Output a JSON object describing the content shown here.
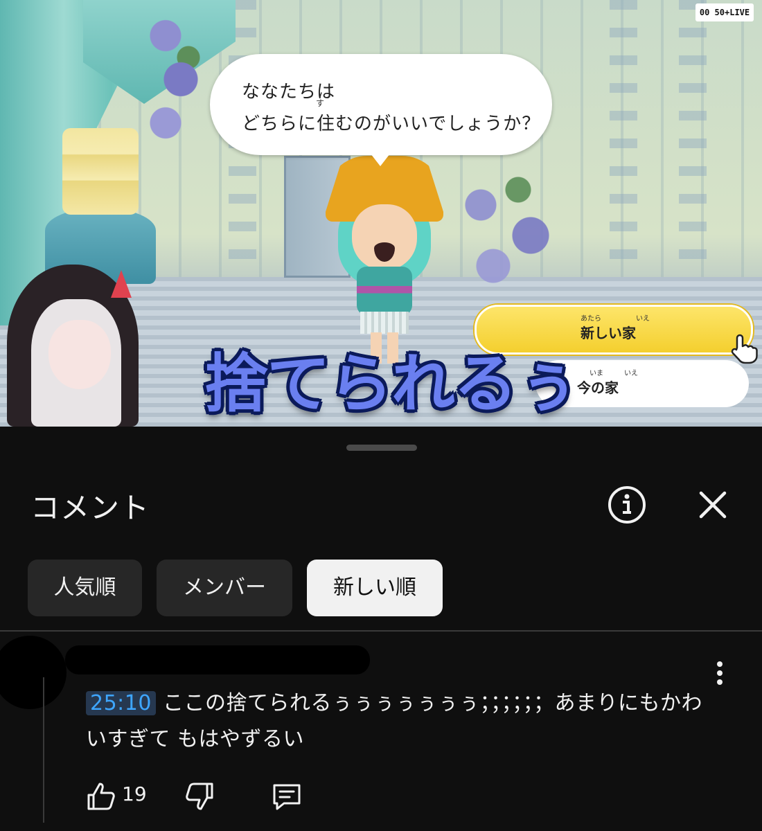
{
  "video": {
    "live_badge": "00 50+LIVE",
    "speech": {
      "line1": "ななたちは",
      "line2": "どちらに住むのがいいでしょうか？",
      "ruby_su": "す"
    },
    "choices": {
      "new_house": {
        "label": "新しい家",
        "ruby_atara": "あたら",
        "ruby_ie": "いえ"
      },
      "current_house": {
        "label": "今の家",
        "ruby_ima": "いま",
        "ruby_ie": "いえ"
      }
    },
    "big_caption": "捨てられるぅ"
  },
  "comments_panel": {
    "title": "コメント",
    "chips": [
      {
        "label": "人気順"
      },
      {
        "label": "メンバー"
      },
      {
        "label": "新しい順"
      }
    ],
    "selected_chip": "新しい順",
    "comment": {
      "timestamp": "25:10",
      "text": " ここの捨てられるぅぅぅぅぅぅぅ；；；；；；あまりにもかわいすぎて もはやずるい",
      "like_count": "19"
    }
  },
  "colors": {
    "panel_bg": "#0f0f0f",
    "chip_bg": "#272727",
    "chip_selected_bg": "#f1f1f1",
    "timestamp_link": "#3ea6ff",
    "caption_fill": "#6a7ff0",
    "choice_selected": "#f4cf2e"
  },
  "icons": {
    "info": "info-icon",
    "close": "close-icon",
    "more": "more-vert-icon",
    "like": "thumb-up-icon",
    "dislike": "thumb-down-icon",
    "reply": "reply-icon",
    "pointer": "hand-pointer-icon"
  }
}
